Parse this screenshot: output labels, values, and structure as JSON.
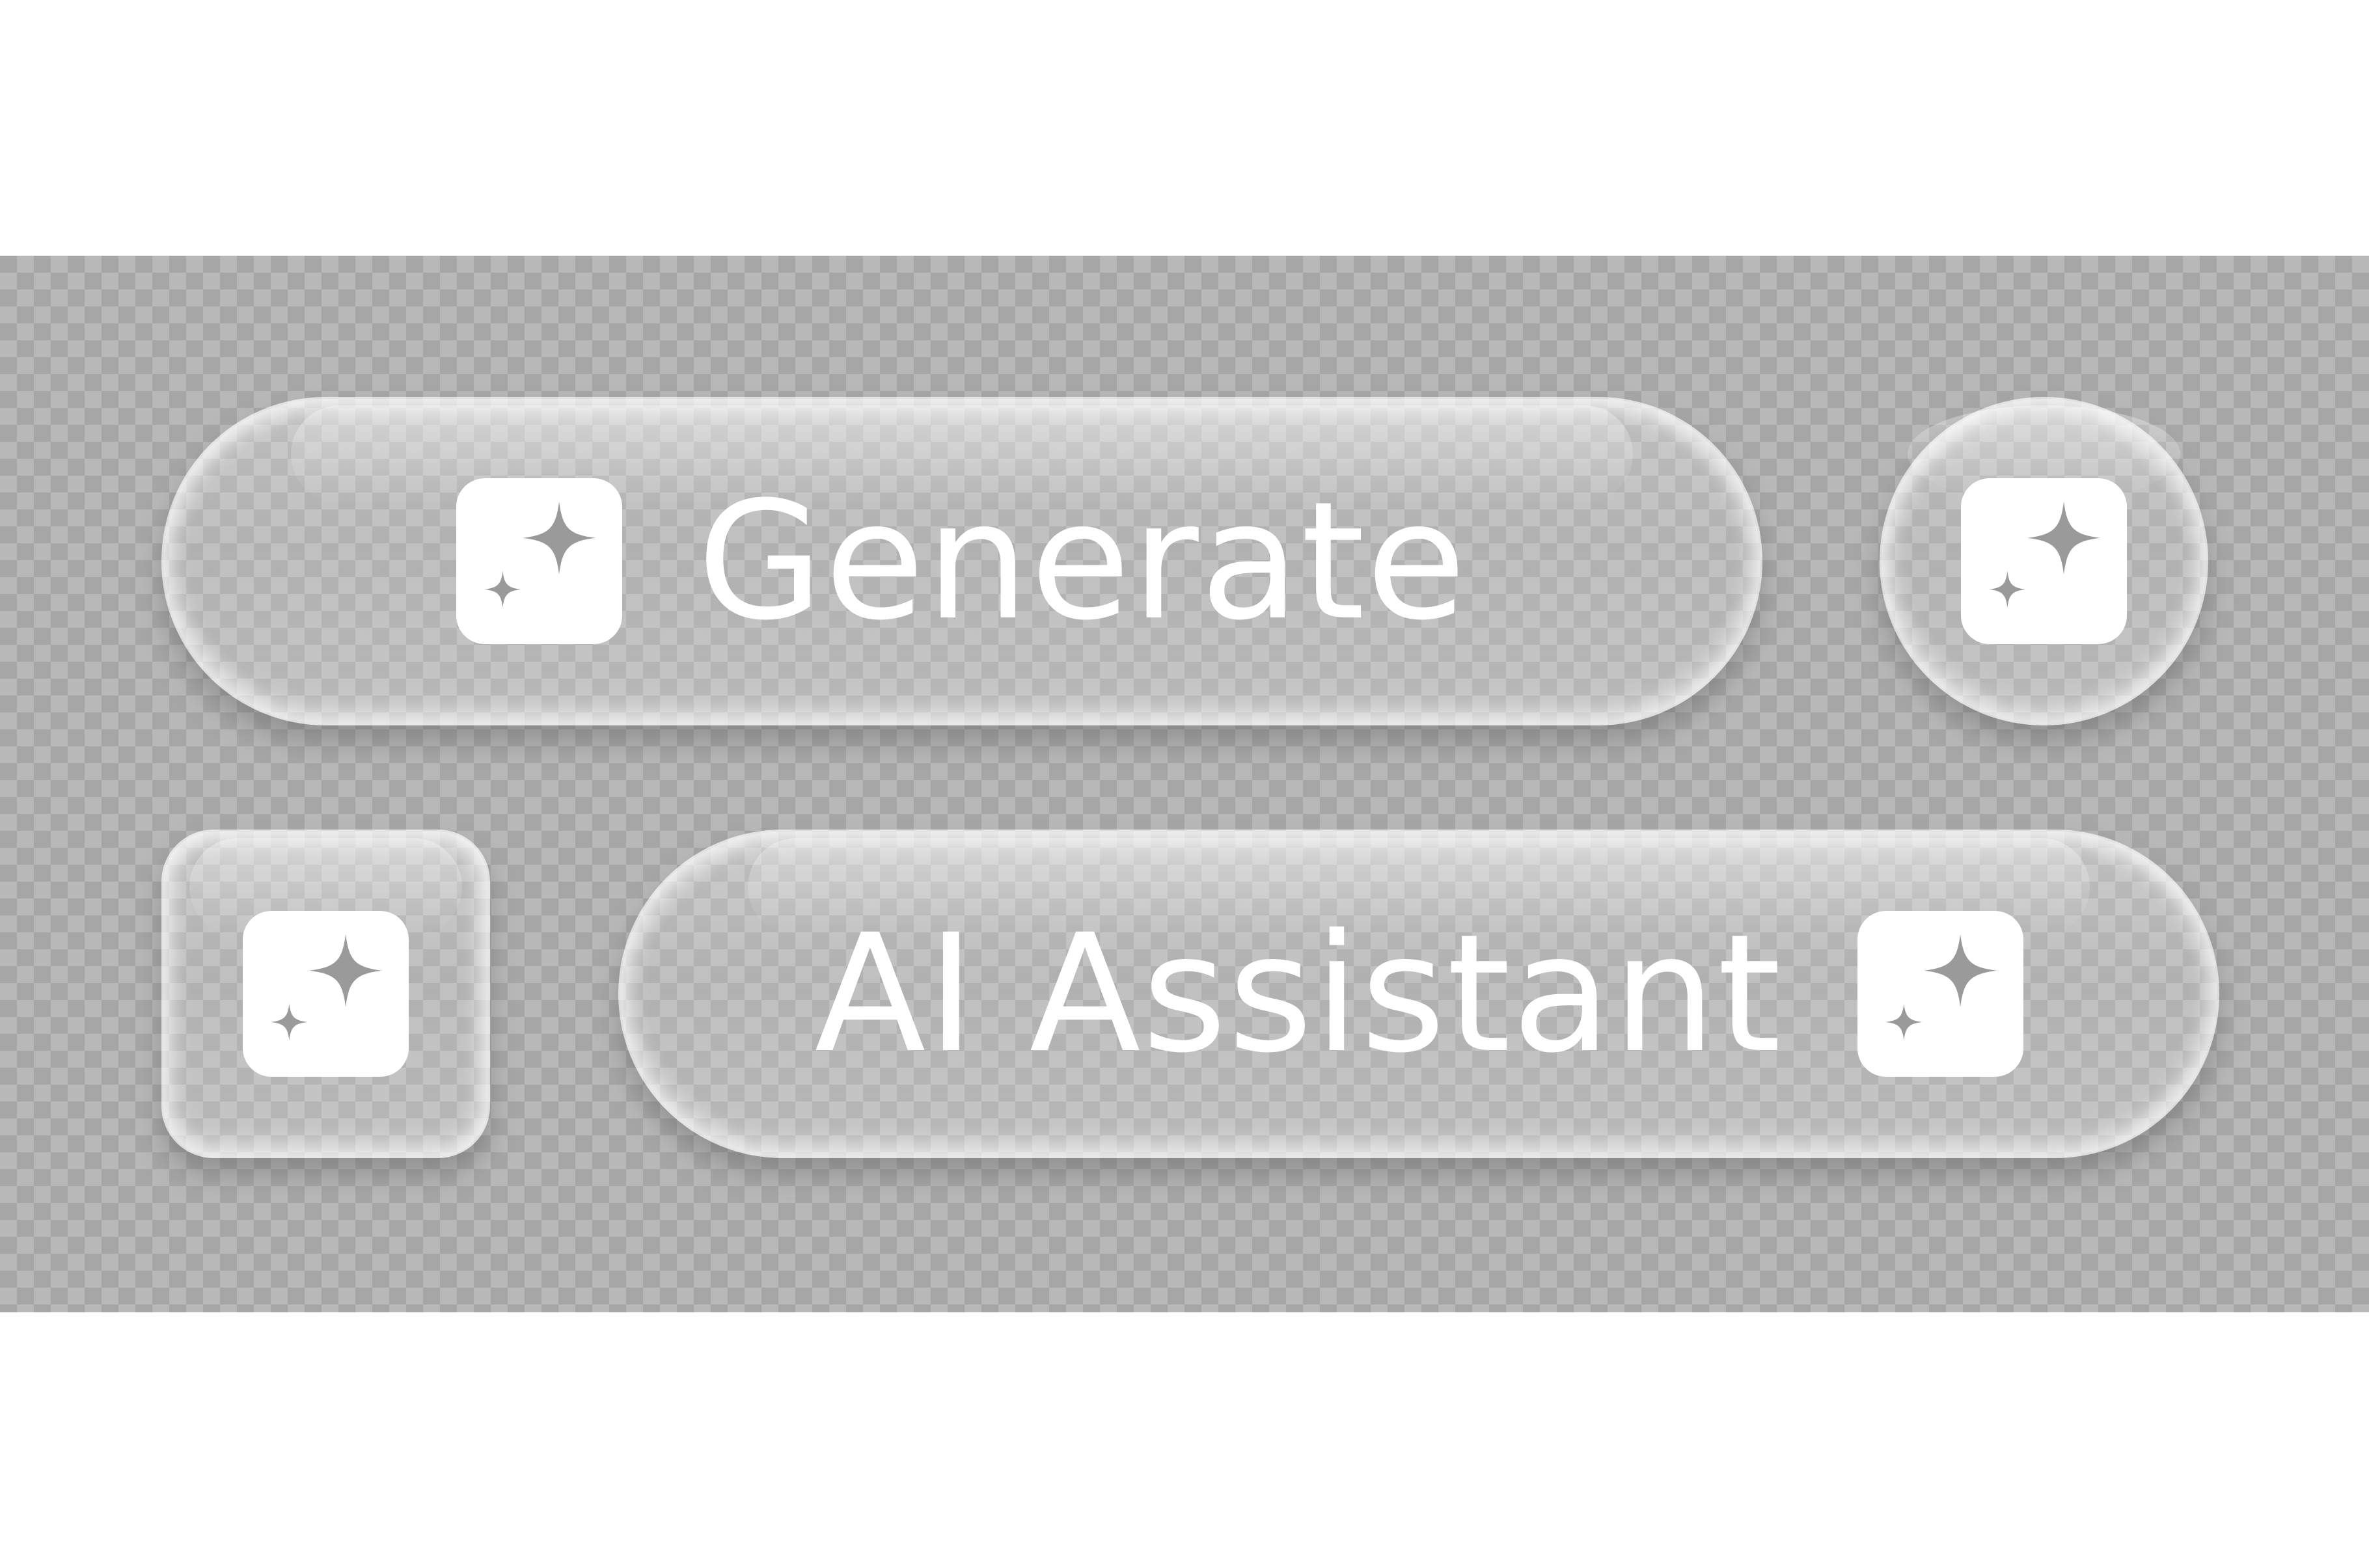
{
  "buttons": {
    "generate": {
      "label": "Generate",
      "icon": "sparkle-icon"
    },
    "circle": {
      "icon": "sparkle-icon"
    },
    "square": {
      "icon": "sparkle-icon"
    },
    "assistant": {
      "label": "AI Assistant",
      "icon": "sparkle-icon"
    }
  },
  "colors": {
    "checker_dark": "#a6a6a6",
    "checker_light": "#b8b8b8",
    "icon_fill": "#ffffff",
    "text": "#ffffff"
  }
}
